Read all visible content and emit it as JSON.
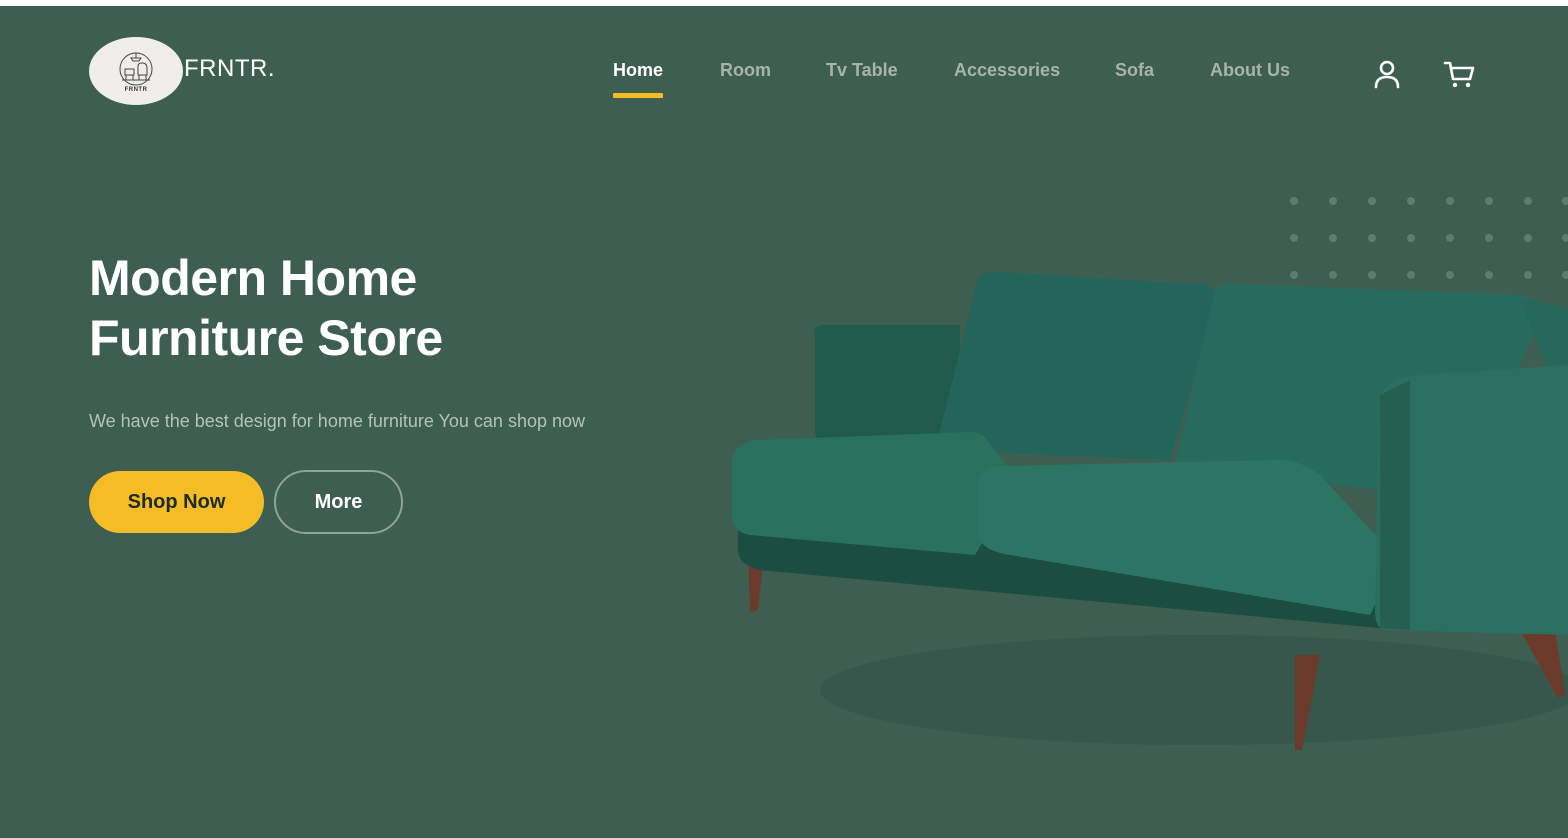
{
  "brand": {
    "name": "FRNTR.",
    "badge_text": "FRNTR",
    "logo_icon": "furniture-logo-icon"
  },
  "nav": {
    "items": [
      {
        "label": "Home",
        "active": true
      },
      {
        "label": "Room",
        "active": false
      },
      {
        "label": "Tv Table",
        "active": false
      },
      {
        "label": "Accessories",
        "active": false
      },
      {
        "label": "Sofa",
        "active": false
      },
      {
        "label": "About Us",
        "active": false
      }
    ],
    "icons": [
      "user-icon",
      "cart-icon"
    ]
  },
  "hero": {
    "title_line1": "Modern Home",
    "title_line2": "Furniture Store",
    "subtitle": "We have the best design for home furniture You can shop now",
    "primary_button": "Shop Now",
    "secondary_button": "More",
    "image": "green-velvet-sofa"
  },
  "colors": {
    "background": "#3d5e50",
    "accent": "#f5bd25",
    "nav_inactive": "#a7b4ad",
    "text_light": "#ffffff"
  }
}
